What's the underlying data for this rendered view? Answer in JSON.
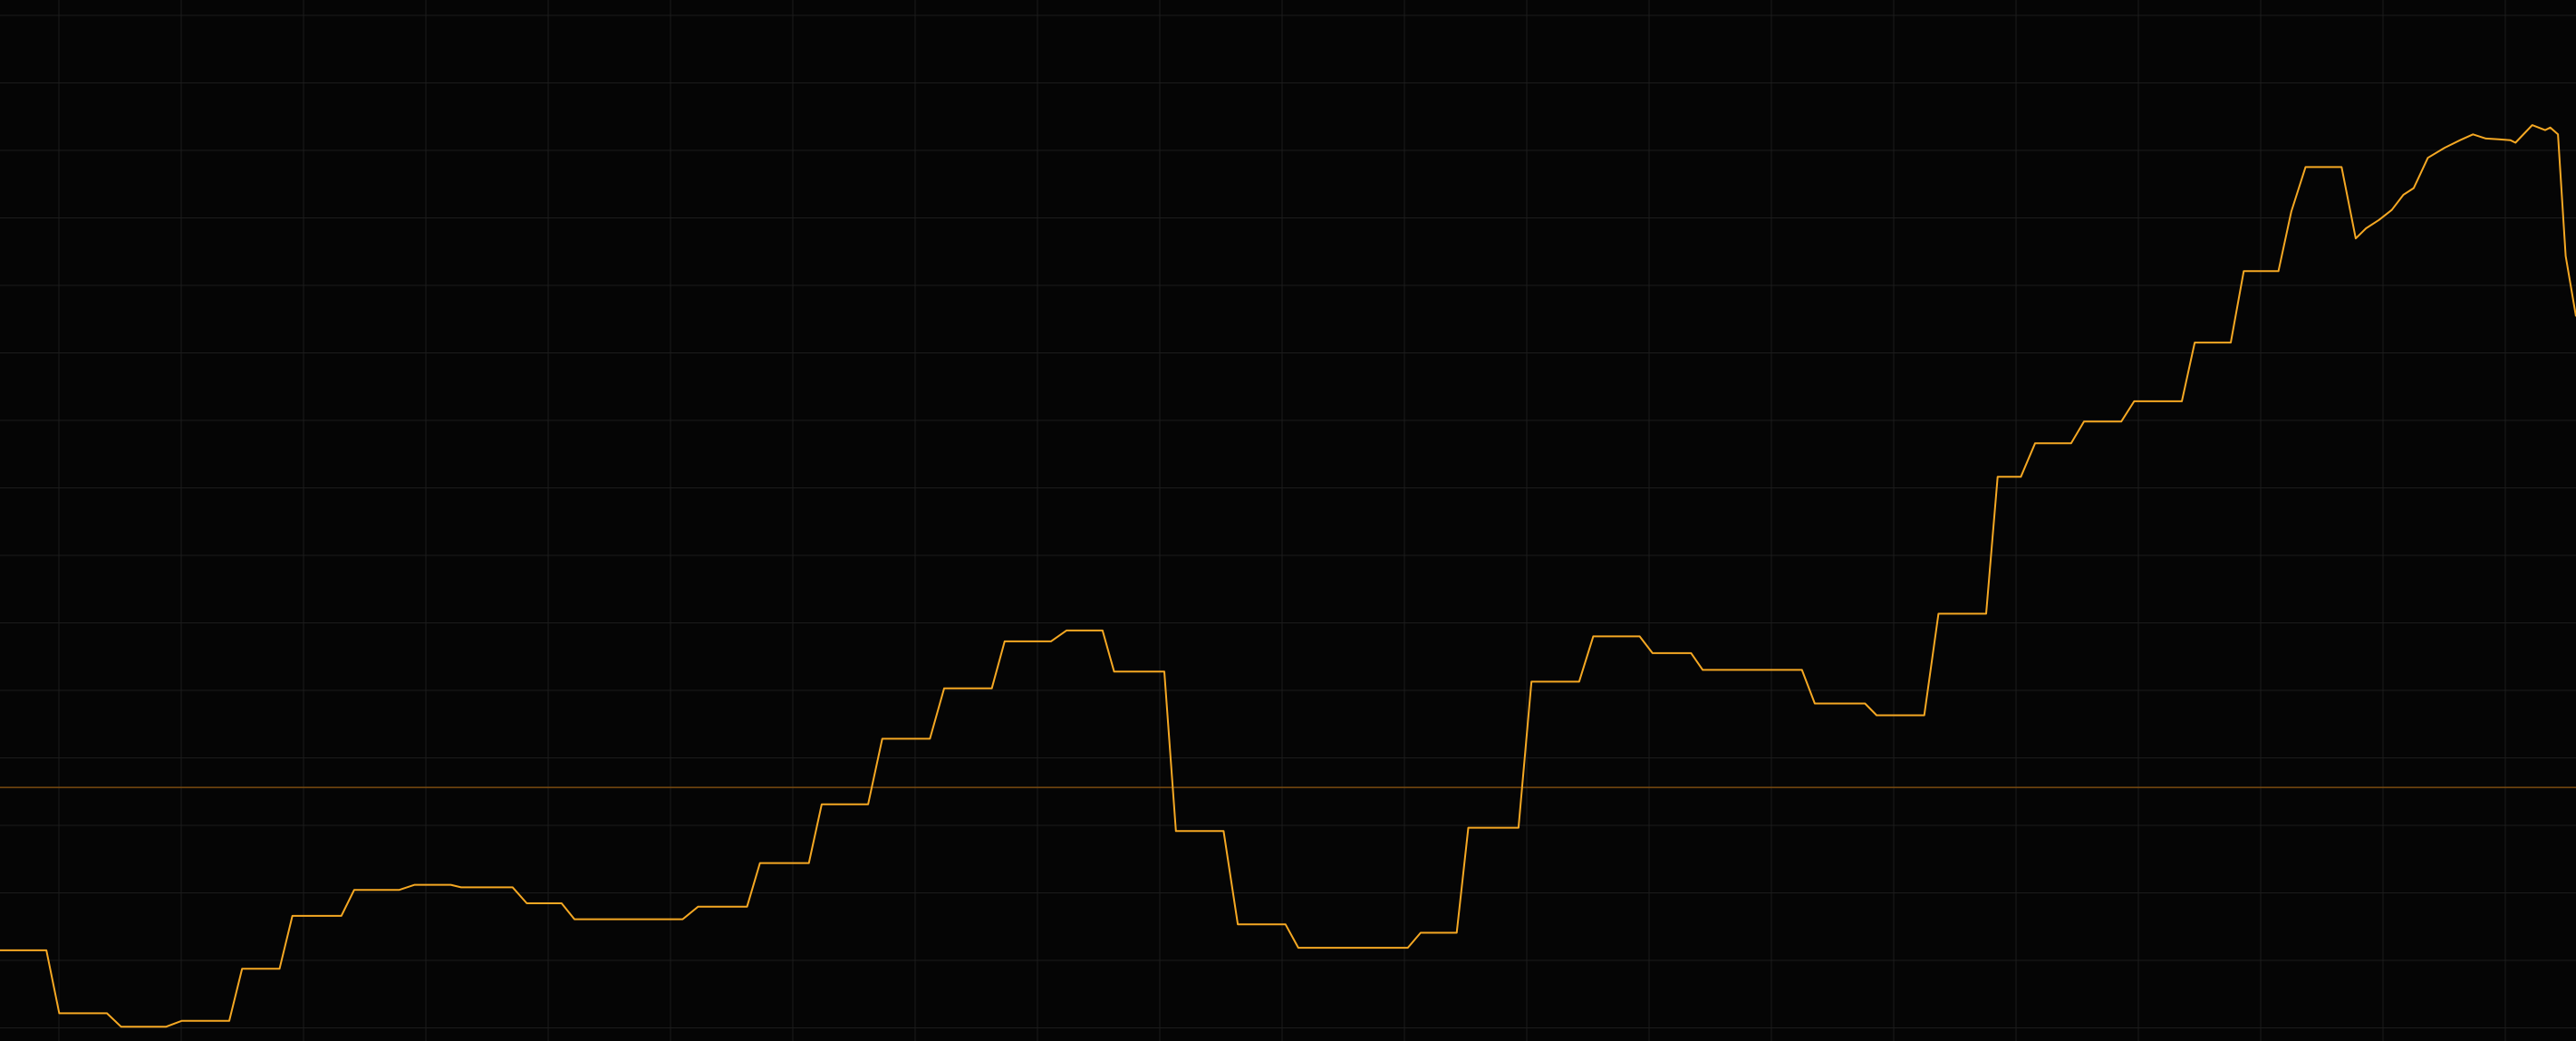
{
  "chart_data": {
    "type": "line",
    "title": "",
    "xlabel": "",
    "ylabel": "",
    "grid": true,
    "legend": "none",
    "x_range": [
      0,
      200
    ],
    "y_range": [
      0,
      620
    ],
    "reference_line": {
      "y": 151
    },
    "colors": {
      "background": "#050505",
      "grid": "#1c1c1c",
      "line": "#f5a823",
      "reference_line": "#7a4a0f"
    },
    "series": [
      {
        "points": [
          [
            0.0,
            54.0
          ],
          [
            3.6,
            54.0
          ],
          [
            4.6,
            16.5
          ],
          [
            8.3,
            16.5
          ],
          [
            9.4,
            8.5
          ],
          [
            12.9,
            8.5
          ],
          [
            14.1,
            12.0
          ],
          [
            17.8,
            12.0
          ],
          [
            18.8,
            43.0
          ],
          [
            21.7,
            43.0
          ],
          [
            22.7,
            74.5
          ],
          [
            26.5,
            74.5
          ],
          [
            27.5,
            90.0
          ],
          [
            31.0,
            90.0
          ],
          [
            32.2,
            93.0
          ],
          [
            35.0,
            93.0
          ],
          [
            35.8,
            91.5
          ],
          [
            39.8,
            91.5
          ],
          [
            40.9,
            82.0
          ],
          [
            43.6,
            82.0
          ],
          [
            44.6,
            72.5
          ],
          [
            53.0,
            72.5
          ],
          [
            54.2,
            80.0
          ],
          [
            58.0,
            80.0
          ],
          [
            59.0,
            106.0
          ],
          [
            62.8,
            106.0
          ],
          [
            63.8,
            141.0
          ],
          [
            67.4,
            141.0
          ],
          [
            68.5,
            180.0
          ],
          [
            72.2,
            180.0
          ],
          [
            73.3,
            210.0
          ],
          [
            77.0,
            210.0
          ],
          [
            78.0,
            238.0
          ],
          [
            81.6,
            238.0
          ],
          [
            82.8,
            244.5
          ],
          [
            85.6,
            244.5
          ],
          [
            86.5,
            220.0
          ],
          [
            90.4,
            220.0
          ],
          [
            91.3,
            125.0
          ],
          [
            95.0,
            125.0
          ],
          [
            96.1,
            69.5
          ],
          [
            99.8,
            69.5
          ],
          [
            100.8,
            55.5
          ],
          [
            109.3,
            55.5
          ],
          [
            110.3,
            64.5
          ],
          [
            113.1,
            64.5
          ],
          [
            114.0,
            127.0
          ],
          [
            117.9,
            127.0
          ],
          [
            118.9,
            214.0
          ],
          [
            122.6,
            214.0
          ],
          [
            123.7,
            241.0
          ],
          [
            127.3,
            241.0
          ],
          [
            128.3,
            231.0
          ],
          [
            131.3,
            231.0
          ],
          [
            132.2,
            221.0
          ],
          [
            139.9,
            221.0
          ],
          [
            140.9,
            201.0
          ],
          [
            144.8,
            201.0
          ],
          [
            145.7,
            194.0
          ],
          [
            149.4,
            194.0
          ],
          [
            150.5,
            254.5
          ],
          [
            154.2,
            254.5
          ],
          [
            155.1,
            336.0
          ],
          [
            156.9,
            336.0
          ],
          [
            158.0,
            356.0
          ],
          [
            160.8,
            356.0
          ],
          [
            161.8,
            369.0
          ],
          [
            164.7,
            369.0
          ],
          [
            165.7,
            381.0
          ],
          [
            169.4,
            381.0
          ],
          [
            170.4,
            416.0
          ],
          [
            173.2,
            416.0
          ],
          [
            174.2,
            458.5
          ],
          [
            176.9,
            458.5
          ],
          [
            177.9,
            494.0
          ],
          [
            179.0,
            520.5
          ],
          [
            181.8,
            520.5
          ],
          [
            182.9,
            478.0
          ],
          [
            183.7,
            484.0
          ],
          [
            184.7,
            489.0
          ],
          [
            185.7,
            495.0
          ],
          [
            186.6,
            504.0
          ],
          [
            187.4,
            508.0
          ],
          [
            188.5,
            526.0
          ],
          [
            189.8,
            532.0
          ],
          [
            191.0,
            536.5
          ],
          [
            192.0,
            540.0
          ],
          [
            193.0,
            537.5
          ],
          [
            194.0,
            537.0
          ],
          [
            194.9,
            536.5
          ],
          [
            195.3,
            535.0
          ],
          [
            196.6,
            545.5
          ],
          [
            197.6,
            542.5
          ],
          [
            198.0,
            544.0
          ],
          [
            198.6,
            540.0
          ],
          [
            199.2,
            467.5
          ],
          [
            200.0,
            431.5
          ]
        ]
      }
    ]
  }
}
